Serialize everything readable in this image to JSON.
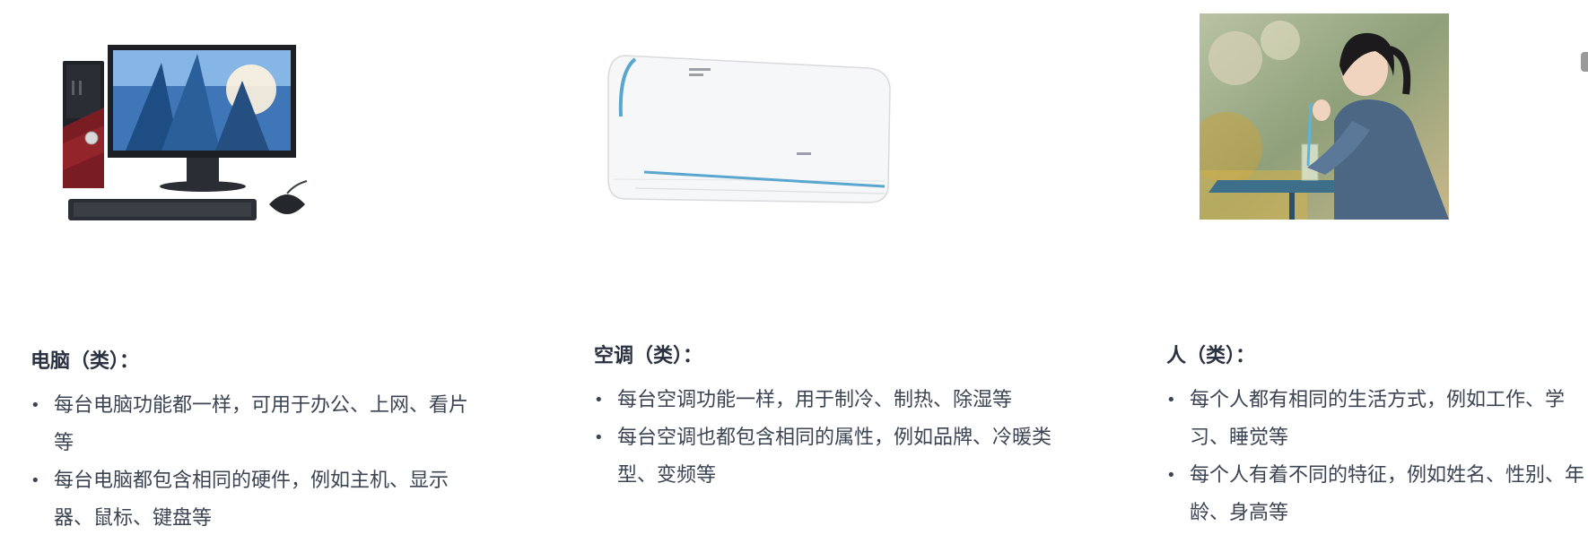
{
  "columns": [
    {
      "heading": "电脑（类）：",
      "illustration": "desktop-computer",
      "points": [
        "每台电脑功能都一样，可用于办公、上网、看片等",
        "每台电脑都包含相同的硬件，例如主机、显示器、鼠标、键盘等"
      ]
    },
    {
      "heading": "空调（类）：",
      "illustration": "air-conditioner",
      "points": [
        "每台空调功能一样，用于制冷、制热、除湿等",
        "每台空调也都包含相同的属性，例如品牌、冷暖类型、变频等"
      ]
    },
    {
      "heading": "人（类）：",
      "illustration": "person-photo",
      "points": [
        "每个人都有相同的生活方式，例如工作、学习、睡觉等",
        "每个人有着不同的特征，例如姓名、性别、年龄、身高等"
      ]
    }
  ],
  "bullet_glyph": "•"
}
